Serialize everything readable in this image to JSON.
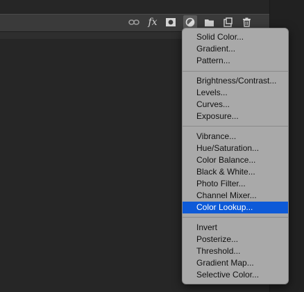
{
  "toolbar": {
    "icons": [
      "link-icon",
      "fx-icon",
      "mask-icon",
      "adjustment-icon",
      "folder-icon",
      "new-layer-icon",
      "trash-icon"
    ],
    "fx_label": "fx"
  },
  "menu": {
    "groups": [
      [
        "Solid Color...",
        "Gradient...",
        "Pattern..."
      ],
      [
        "Brightness/Contrast...",
        "Levels...",
        "Curves...",
        "Exposure..."
      ],
      [
        "Vibrance...",
        "Hue/Saturation...",
        "Color Balance...",
        "Black & White...",
        "Photo Filter...",
        "Channel Mixer...",
        "Color Lookup..."
      ],
      [
        "Invert",
        "Posterize...",
        "Threshold...",
        "Gradient Map...",
        "Selective Color..."
      ]
    ],
    "selected": "Color Lookup...",
    "colors": {
      "menu_bg": "#a9a9a9",
      "selected_bg": "#0d5ad8"
    }
  }
}
